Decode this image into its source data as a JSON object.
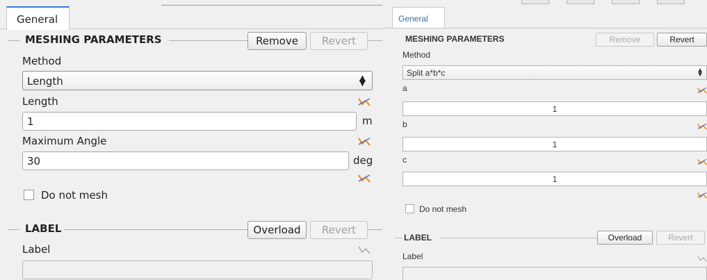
{
  "left": {
    "tab": "General",
    "meshing": {
      "title": "MESHING PARAMETERS",
      "remove": "Remove",
      "revert": "Revert",
      "method_label": "Method",
      "method_value": "Length",
      "length_label": "Length",
      "length_value": "1",
      "length_unit": "m",
      "angle_label": "Maximum Angle",
      "angle_value": "30",
      "angle_unit": "deg",
      "do_not_mesh": "Do not mesh"
    },
    "label_group": {
      "title": "LABEL",
      "overload": "Overload",
      "revert": "Revert",
      "label": "Label",
      "value": ""
    }
  },
  "right": {
    "tab": "General",
    "meshing": {
      "title": "MESHING PARAMETERS",
      "remove": "Remove",
      "revert": "Revert",
      "method_label": "Method",
      "method_value": "Split a*b*c",
      "a_label": "a",
      "a_value": "1",
      "b_label": "b",
      "b_value": "1",
      "c_label": "c",
      "c_value": "1",
      "do_not_mesh": "Do not mesh"
    },
    "label_group": {
      "title": "LABEL",
      "overload": "Overload",
      "revert": "Revert",
      "label": "Label"
    }
  },
  "colors": {
    "tab_accent": "#2f7bd8",
    "graph_icon_active": "#e8891a",
    "graph_icon_series": "#4a78c8",
    "graph_icon_inactive": "#a9a9a9"
  },
  "icons": {
    "select_arrows": "up-down-arrows-icon",
    "graph": "graph-icon"
  }
}
